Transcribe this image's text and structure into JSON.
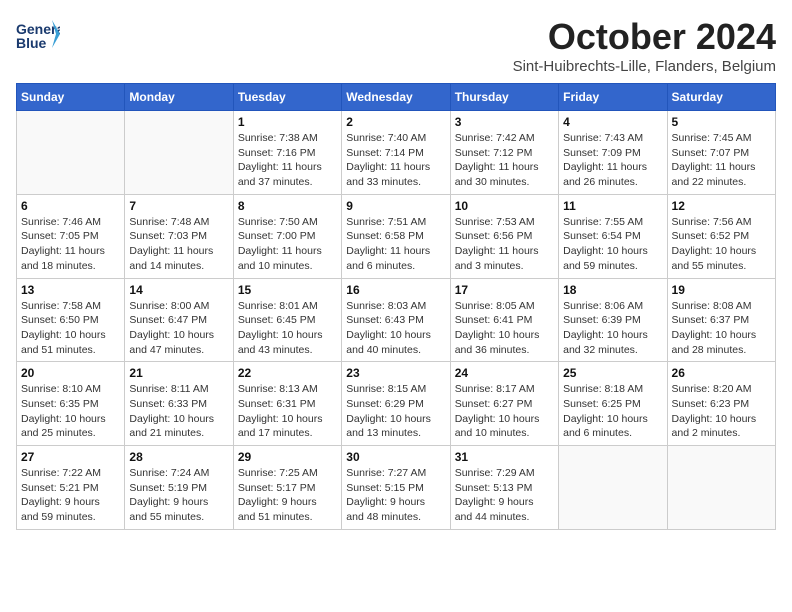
{
  "header": {
    "logo_line1": "General",
    "logo_line2": "Blue",
    "month_title": "October 2024",
    "location": "Sint-Huibrechts-Lille, Flanders, Belgium"
  },
  "weekdays": [
    "Sunday",
    "Monday",
    "Tuesday",
    "Wednesday",
    "Thursday",
    "Friday",
    "Saturday"
  ],
  "weeks": [
    [
      {
        "day": "",
        "info": ""
      },
      {
        "day": "",
        "info": ""
      },
      {
        "day": "1",
        "info": "Sunrise: 7:38 AM\nSunset: 7:16 PM\nDaylight: 11 hours\nand 37 minutes."
      },
      {
        "day": "2",
        "info": "Sunrise: 7:40 AM\nSunset: 7:14 PM\nDaylight: 11 hours\nand 33 minutes."
      },
      {
        "day": "3",
        "info": "Sunrise: 7:42 AM\nSunset: 7:12 PM\nDaylight: 11 hours\nand 30 minutes."
      },
      {
        "day": "4",
        "info": "Sunrise: 7:43 AM\nSunset: 7:09 PM\nDaylight: 11 hours\nand 26 minutes."
      },
      {
        "day": "5",
        "info": "Sunrise: 7:45 AM\nSunset: 7:07 PM\nDaylight: 11 hours\nand 22 minutes."
      }
    ],
    [
      {
        "day": "6",
        "info": "Sunrise: 7:46 AM\nSunset: 7:05 PM\nDaylight: 11 hours\nand 18 minutes."
      },
      {
        "day": "7",
        "info": "Sunrise: 7:48 AM\nSunset: 7:03 PM\nDaylight: 11 hours\nand 14 minutes."
      },
      {
        "day": "8",
        "info": "Sunrise: 7:50 AM\nSunset: 7:00 PM\nDaylight: 11 hours\nand 10 minutes."
      },
      {
        "day": "9",
        "info": "Sunrise: 7:51 AM\nSunset: 6:58 PM\nDaylight: 11 hours\nand 6 minutes."
      },
      {
        "day": "10",
        "info": "Sunrise: 7:53 AM\nSunset: 6:56 PM\nDaylight: 11 hours\nand 3 minutes."
      },
      {
        "day": "11",
        "info": "Sunrise: 7:55 AM\nSunset: 6:54 PM\nDaylight: 10 hours\nand 59 minutes."
      },
      {
        "day": "12",
        "info": "Sunrise: 7:56 AM\nSunset: 6:52 PM\nDaylight: 10 hours\nand 55 minutes."
      }
    ],
    [
      {
        "day": "13",
        "info": "Sunrise: 7:58 AM\nSunset: 6:50 PM\nDaylight: 10 hours\nand 51 minutes."
      },
      {
        "day": "14",
        "info": "Sunrise: 8:00 AM\nSunset: 6:47 PM\nDaylight: 10 hours\nand 47 minutes."
      },
      {
        "day": "15",
        "info": "Sunrise: 8:01 AM\nSunset: 6:45 PM\nDaylight: 10 hours\nand 43 minutes."
      },
      {
        "day": "16",
        "info": "Sunrise: 8:03 AM\nSunset: 6:43 PM\nDaylight: 10 hours\nand 40 minutes."
      },
      {
        "day": "17",
        "info": "Sunrise: 8:05 AM\nSunset: 6:41 PM\nDaylight: 10 hours\nand 36 minutes."
      },
      {
        "day": "18",
        "info": "Sunrise: 8:06 AM\nSunset: 6:39 PM\nDaylight: 10 hours\nand 32 minutes."
      },
      {
        "day": "19",
        "info": "Sunrise: 8:08 AM\nSunset: 6:37 PM\nDaylight: 10 hours\nand 28 minutes."
      }
    ],
    [
      {
        "day": "20",
        "info": "Sunrise: 8:10 AM\nSunset: 6:35 PM\nDaylight: 10 hours\nand 25 minutes."
      },
      {
        "day": "21",
        "info": "Sunrise: 8:11 AM\nSunset: 6:33 PM\nDaylight: 10 hours\nand 21 minutes."
      },
      {
        "day": "22",
        "info": "Sunrise: 8:13 AM\nSunset: 6:31 PM\nDaylight: 10 hours\nand 17 minutes."
      },
      {
        "day": "23",
        "info": "Sunrise: 8:15 AM\nSunset: 6:29 PM\nDaylight: 10 hours\nand 13 minutes."
      },
      {
        "day": "24",
        "info": "Sunrise: 8:17 AM\nSunset: 6:27 PM\nDaylight: 10 hours\nand 10 minutes."
      },
      {
        "day": "25",
        "info": "Sunrise: 8:18 AM\nSunset: 6:25 PM\nDaylight: 10 hours\nand 6 minutes."
      },
      {
        "day": "26",
        "info": "Sunrise: 8:20 AM\nSunset: 6:23 PM\nDaylight: 10 hours\nand 2 minutes."
      }
    ],
    [
      {
        "day": "27",
        "info": "Sunrise: 7:22 AM\nSunset: 5:21 PM\nDaylight: 9 hours\nand 59 minutes."
      },
      {
        "day": "28",
        "info": "Sunrise: 7:24 AM\nSunset: 5:19 PM\nDaylight: 9 hours\nand 55 minutes."
      },
      {
        "day": "29",
        "info": "Sunrise: 7:25 AM\nSunset: 5:17 PM\nDaylight: 9 hours\nand 51 minutes."
      },
      {
        "day": "30",
        "info": "Sunrise: 7:27 AM\nSunset: 5:15 PM\nDaylight: 9 hours\nand 48 minutes."
      },
      {
        "day": "31",
        "info": "Sunrise: 7:29 AM\nSunset: 5:13 PM\nDaylight: 9 hours\nand 44 minutes."
      },
      {
        "day": "",
        "info": ""
      },
      {
        "day": "",
        "info": ""
      }
    ]
  ]
}
